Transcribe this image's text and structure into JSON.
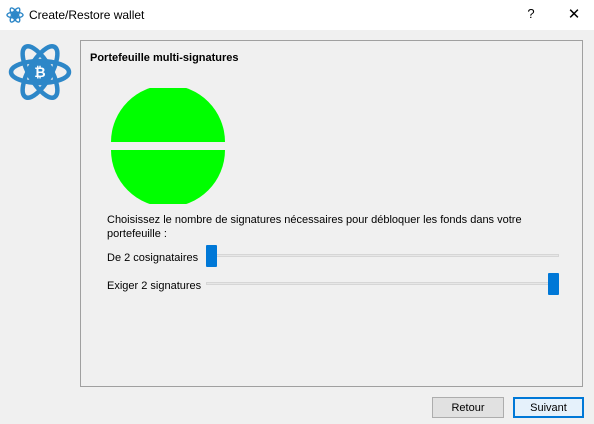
{
  "window": {
    "title": "Create/Restore wallet",
    "help_label": "?",
    "close_label": "✕"
  },
  "icons": {
    "app": "electrum-atom-icon",
    "logo": "electrum-logo-icon",
    "indicator": "multisig-indicator-icon"
  },
  "colors": {
    "accent": "#0078d7",
    "logo_blue": "#2d87c8",
    "indicator_green": "#00ff00"
  },
  "panel": {
    "title": "Portefeuille multi-signatures",
    "instructions": "Choisissez le nombre de signatures nécessaires pour débloquer les fonds dans votre portefeuille :"
  },
  "cosigners": {
    "label": "De 2 cosignataires",
    "value": 2
  },
  "signatures": {
    "label": "Exiger 2 signatures",
    "value": 2
  },
  "buttons": {
    "back": "Retour",
    "next": "Suivant"
  }
}
